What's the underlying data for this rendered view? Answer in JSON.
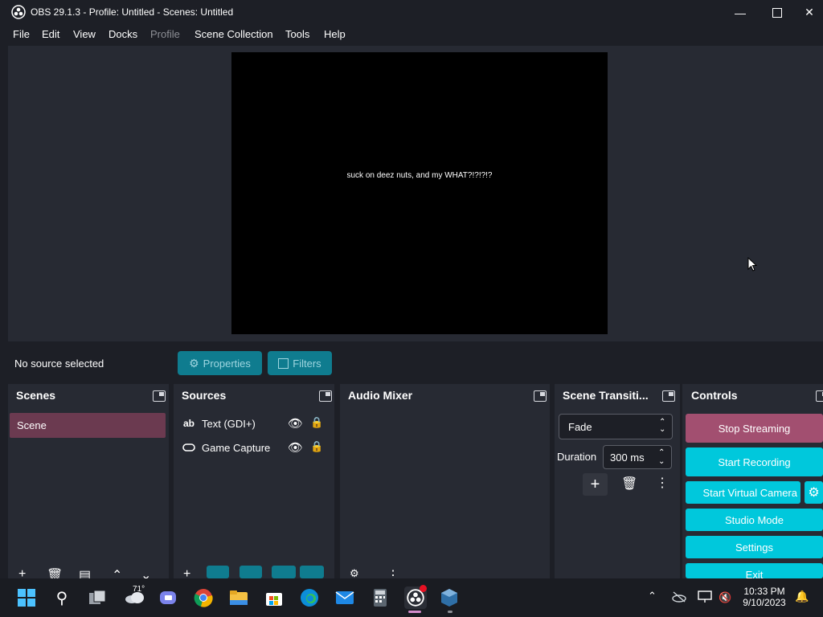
{
  "window": {
    "title": "OBS 29.1.3 - Profile: Untitled - Scenes: Untitled"
  },
  "menu": [
    "File",
    "Edit",
    "View",
    "Docks",
    "Profile",
    "Scene Collection",
    "Tools",
    "Help"
  ],
  "preview": {
    "text": "suck on deez nuts, and my WHAT?!?!?!?"
  },
  "status": {
    "no_source": "No source selected",
    "properties": "Properties",
    "filters": "Filters"
  },
  "docks": {
    "scenes": {
      "title": "Scenes",
      "items": [
        "Scene"
      ]
    },
    "sources": {
      "title": "Sources",
      "items": [
        {
          "icon": "text-icon",
          "glyph": "ab",
          "label": "Text (GDI+)"
        },
        {
          "icon": "gamepad-icon",
          "glyph": "",
          "label": "Game Capture"
        }
      ]
    },
    "audio": {
      "title": "Audio Mixer"
    },
    "transitions": {
      "title": "Scene Transiti...",
      "selected": "Fade",
      "duration_label": "Duration",
      "duration_value": "300 ms"
    },
    "controls": {
      "title": "Controls",
      "buttons": {
        "stop_streaming": "Stop Streaming",
        "start_recording": "Start Recording",
        "virtual_camera": "Start Virtual Camera",
        "studio_mode": "Studio Mode",
        "settings": "Settings",
        "exit": "Exit"
      }
    }
  },
  "taskbar": {
    "weather": "71°",
    "time": "10:33 PM",
    "date": "9/10/2023"
  },
  "colors": {
    "accent": "#00c8dc",
    "scene_selected": "#6b3a50",
    "stop_streaming": "#a24f70",
    "background": "#1d1f26",
    "panel": "#272a33"
  }
}
